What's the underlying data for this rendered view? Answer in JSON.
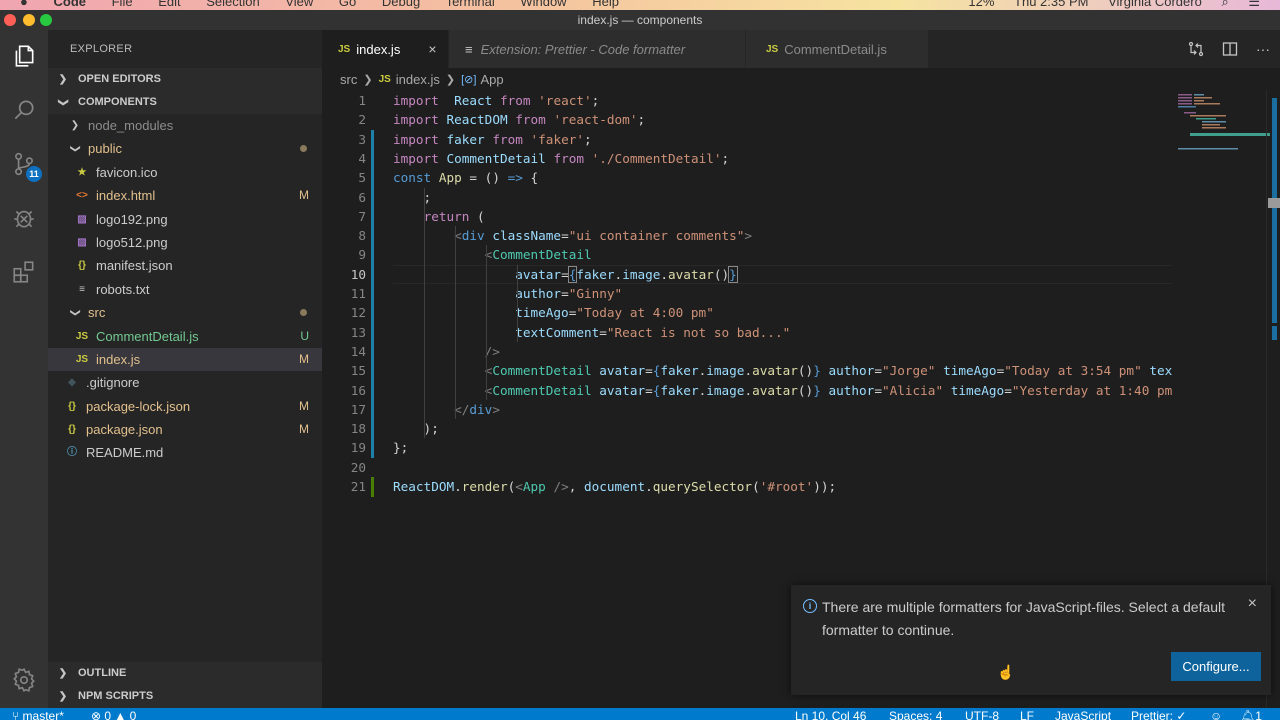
{
  "menubar": {
    "app": "Code",
    "items": [
      "File",
      "Edit",
      "Selection",
      "View",
      "Go",
      "Debug",
      "Terminal",
      "Window",
      "Help"
    ],
    "battery": "12%",
    "clock": "Thu 2:35 PM",
    "user": "Virginia Cordero"
  },
  "window": {
    "title": "index.js — components"
  },
  "activity_bar": {
    "items": [
      {
        "name": "explorer",
        "icon": "files-icon"
      },
      {
        "name": "search",
        "icon": "search-icon"
      },
      {
        "name": "source-control",
        "icon": "source-control-icon",
        "badge": "11"
      },
      {
        "name": "debug",
        "icon": "debug-icon"
      },
      {
        "name": "extensions",
        "icon": "extensions-icon"
      }
    ],
    "settings_icon": "gear-icon"
  },
  "sidebar": {
    "title": "EXPLORER",
    "sections": {
      "open_editors": "OPEN EDITORS",
      "project": "COMPONENTS",
      "outline": "OUTLINE",
      "npm_scripts": "NPM SCRIPTS"
    },
    "tree": [
      {
        "label": "node_modules",
        "type": "folder",
        "expanded": false,
        "depth": 1,
        "status": ""
      },
      {
        "label": "public",
        "type": "folder",
        "expanded": true,
        "depth": 1,
        "status": "dot"
      },
      {
        "label": "favicon.ico",
        "type": "file",
        "icon": "star-icon",
        "depth": 2,
        "status": ""
      },
      {
        "label": "index.html",
        "type": "file",
        "icon": "html-icon",
        "depth": 2,
        "status": "M"
      },
      {
        "label": "logo192.png",
        "type": "file",
        "icon": "image-icon",
        "depth": 2,
        "status": ""
      },
      {
        "label": "logo512.png",
        "type": "file",
        "icon": "image-icon",
        "depth": 2,
        "status": ""
      },
      {
        "label": "manifest.json",
        "type": "file",
        "icon": "json-icon",
        "depth": 2,
        "status": ""
      },
      {
        "label": "robots.txt",
        "type": "file",
        "icon": "text-icon",
        "depth": 2,
        "status": ""
      },
      {
        "label": "src",
        "type": "folder",
        "expanded": true,
        "depth": 1,
        "status": "dot"
      },
      {
        "label": "CommentDetail.js",
        "type": "file",
        "icon": "js-icon",
        "depth": 2,
        "status": "U"
      },
      {
        "label": "index.js",
        "type": "file",
        "icon": "js-icon",
        "depth": 2,
        "status": "M",
        "selected": true
      },
      {
        "label": ".gitignore",
        "type": "file",
        "icon": "git-icon",
        "depth": 1,
        "status": ""
      },
      {
        "label": "package-lock.json",
        "type": "file",
        "icon": "json-icon",
        "depth": 1,
        "status": "M"
      },
      {
        "label": "package.json",
        "type": "file",
        "icon": "json-icon",
        "depth": 1,
        "status": "M"
      },
      {
        "label": "README.md",
        "type": "file",
        "icon": "info-icon",
        "depth": 1,
        "status": ""
      }
    ]
  },
  "tabs": [
    {
      "label": "index.js",
      "icon": "JS",
      "active": true,
      "close": "×"
    },
    {
      "label": "Extension: Prettier - Code formatter",
      "icon": "≡",
      "active": false,
      "italic": true
    },
    {
      "label": "CommentDetail.js",
      "icon": "JS",
      "active": false
    }
  ],
  "breadcrumb": {
    "folder": "src",
    "file": "index.js",
    "file_icon": "JS",
    "symbol": "App",
    "symbol_icon": "[⊘]"
  },
  "editor": {
    "current_line": 10,
    "lines": [
      {
        "n": "1"
      },
      {
        "n": "2"
      },
      {
        "n": "3"
      },
      {
        "n": "4"
      },
      {
        "n": "5"
      },
      {
        "n": "6"
      },
      {
        "n": "7"
      },
      {
        "n": "8"
      },
      {
        "n": "9"
      },
      {
        "n": "10"
      },
      {
        "n": "11"
      },
      {
        "n": "12"
      },
      {
        "n": "13"
      },
      {
        "n": "14"
      },
      {
        "n": "15"
      },
      {
        "n": "16"
      },
      {
        "n": "17"
      },
      {
        "n": "18"
      },
      {
        "n": "19"
      },
      {
        "n": "20"
      },
      {
        "n": "21"
      }
    ],
    "tokens": {
      "l1": [
        [
          "kw",
          "import"
        ],
        [
          "",
          "  "
        ],
        [
          "id",
          "React"
        ],
        [
          "",
          " "
        ],
        [
          "kw",
          "from"
        ],
        [
          "",
          " "
        ],
        [
          "str",
          "'react'"
        ],
        [
          "",
          ";"
        ]
      ],
      "l2": [
        [
          "kw",
          "import"
        ],
        [
          "",
          " "
        ],
        [
          "id",
          "ReactDOM"
        ],
        [
          "",
          " "
        ],
        [
          "kw",
          "from"
        ],
        [
          "",
          " "
        ],
        [
          "str",
          "'react-dom'"
        ],
        [
          "",
          ";"
        ]
      ],
      "l3": [
        [
          "kw",
          "import"
        ],
        [
          "",
          " "
        ],
        [
          "id",
          "faker"
        ],
        [
          "",
          " "
        ],
        [
          "kw",
          "from"
        ],
        [
          "",
          " "
        ],
        [
          "str",
          "'faker'"
        ],
        [
          "",
          ";"
        ]
      ],
      "l4": [
        [
          "kw",
          "import"
        ],
        [
          "",
          " "
        ],
        [
          "id",
          "CommentDetail"
        ],
        [
          "",
          " "
        ],
        [
          "kw",
          "from"
        ],
        [
          "",
          " "
        ],
        [
          "str",
          "'./CommentDetail'"
        ],
        [
          "",
          ";"
        ]
      ],
      "l5": [
        [
          "kb",
          "const"
        ],
        [
          "",
          " "
        ],
        [
          "fn",
          "App"
        ],
        [
          "",
          " = () "
        ],
        [
          "kb",
          "=>"
        ],
        [
          "",
          " {"
        ]
      ],
      "l6": [
        [
          "",
          "    ;"
        ]
      ],
      "l7": [
        [
          "",
          "    "
        ],
        [
          "kw",
          "return"
        ],
        [
          "",
          " ("
        ]
      ],
      "l8": [
        [
          "",
          "        "
        ],
        [
          "pun",
          "<"
        ],
        [
          "kb",
          "div"
        ],
        [
          "",
          " "
        ],
        [
          "id",
          "className"
        ],
        [
          "",
          "="
        ],
        [
          "str",
          "\"ui container comments\""
        ],
        [
          "pun",
          ">"
        ]
      ],
      "l9": [
        [
          "",
          "            "
        ],
        [
          "pun",
          "<"
        ],
        [
          "tag",
          "CommentDetail"
        ]
      ],
      "l10": [
        [
          "",
          "                "
        ],
        [
          "id",
          "avatar"
        ],
        [
          "",
          "="
        ],
        [
          "kb",
          "{"
        ],
        [
          "id",
          "faker"
        ],
        [
          "",
          "."
        ],
        [
          "id",
          "image"
        ],
        [
          "",
          "."
        ],
        [
          "fn",
          "avatar"
        ],
        [
          "",
          "()"
        ],
        [
          "kb",
          "}"
        ]
      ],
      "l11": [
        [
          "",
          "                "
        ],
        [
          "id",
          "author"
        ],
        [
          "",
          "="
        ],
        [
          "str",
          "\"Ginny\""
        ]
      ],
      "l12": [
        [
          "",
          "                "
        ],
        [
          "id",
          "timeAgo"
        ],
        [
          "",
          "="
        ],
        [
          "str",
          "\"Today at 4:00 pm\""
        ]
      ],
      "l13": [
        [
          "",
          "                "
        ],
        [
          "id",
          "textComment"
        ],
        [
          "",
          "="
        ],
        [
          "str",
          "\"React is not so bad...\""
        ]
      ],
      "l14": [
        [
          "",
          "            "
        ],
        [
          "pun",
          "/>"
        ]
      ],
      "l15": [
        [
          "",
          "            "
        ],
        [
          "pun",
          "<"
        ],
        [
          "tag",
          "CommentDetail"
        ],
        [
          "",
          " "
        ],
        [
          "id",
          "avatar"
        ],
        [
          "",
          "="
        ],
        [
          "kb",
          "{"
        ],
        [
          "id",
          "faker"
        ],
        [
          "",
          "."
        ],
        [
          "id",
          "image"
        ],
        [
          "",
          "."
        ],
        [
          "fn",
          "avatar"
        ],
        [
          "",
          "()"
        ],
        [
          "kb",
          "}"
        ],
        [
          "",
          " "
        ],
        [
          "id",
          "author"
        ],
        [
          "",
          "="
        ],
        [
          "str",
          "\"Jorge\""
        ],
        [
          "",
          " "
        ],
        [
          "id",
          "timeAgo"
        ],
        [
          "",
          "="
        ],
        [
          "str",
          "\"Today at 3:54 pm\""
        ],
        [
          "",
          " "
        ],
        [
          "id",
          "textComment"
        ]
      ],
      "l16": [
        [
          "",
          "            "
        ],
        [
          "pun",
          "<"
        ],
        [
          "tag",
          "CommentDetail"
        ],
        [
          "",
          " "
        ],
        [
          "id",
          "avatar"
        ],
        [
          "",
          "="
        ],
        [
          "kb",
          "{"
        ],
        [
          "id",
          "faker"
        ],
        [
          "",
          "."
        ],
        [
          "id",
          "image"
        ],
        [
          "",
          "."
        ],
        [
          "fn",
          "avatar"
        ],
        [
          "",
          "()"
        ],
        [
          "kb",
          "}"
        ],
        [
          "",
          " "
        ],
        [
          "id",
          "author"
        ],
        [
          "",
          "="
        ],
        [
          "str",
          "\"Alicia\""
        ],
        [
          "",
          " "
        ],
        [
          "id",
          "timeAgo"
        ],
        [
          "",
          "="
        ],
        [
          "str",
          "\"Yesterday at 1:40 pm\""
        ]
      ],
      "l17": [
        [
          "",
          "        "
        ],
        [
          "pun",
          "</"
        ],
        [
          "kb",
          "div"
        ],
        [
          "pun",
          ">"
        ]
      ],
      "l18": [
        [
          "",
          "    );"
        ]
      ],
      "l19": [
        [
          "",
          "};"
        ]
      ],
      "l20": [
        [
          "",
          ""
        ]
      ],
      "l21": [
        [
          "id",
          "ReactDOM"
        ],
        [
          "",
          "."
        ],
        [
          "fn",
          "render"
        ],
        [
          "",
          "("
        ],
        [
          "pun",
          "<"
        ],
        [
          "tag",
          "App"
        ],
        [
          "",
          " "
        ],
        [
          "pun",
          "/>"
        ],
        [
          "",
          ", "
        ],
        [
          "id",
          "document"
        ],
        [
          "",
          "."
        ],
        [
          "fn",
          "querySelector"
        ],
        [
          "",
          "("
        ],
        [
          "str",
          "'#root'"
        ],
        [
          "",
          "));"
        ]
      ]
    }
  },
  "notification": {
    "message": "There are multiple formatters for JavaScript-files. Select a default formatter to continue.",
    "button": "Configure...",
    "close": "×",
    "icon": "info-icon"
  },
  "statusbar": {
    "branch": "master*",
    "errors": "0",
    "warnings": "0",
    "position": "Ln 10, Col 46",
    "indent": "Spaces: 4",
    "encoding": "UTF-8",
    "eol": "LF",
    "language": "JavaScript",
    "formatter": "Prettier: ✓",
    "notifications": "1"
  },
  "colors": {
    "accent": "#007acc",
    "button": "#0e639c",
    "modified": "#e2c08d",
    "untracked": "#73c991"
  }
}
